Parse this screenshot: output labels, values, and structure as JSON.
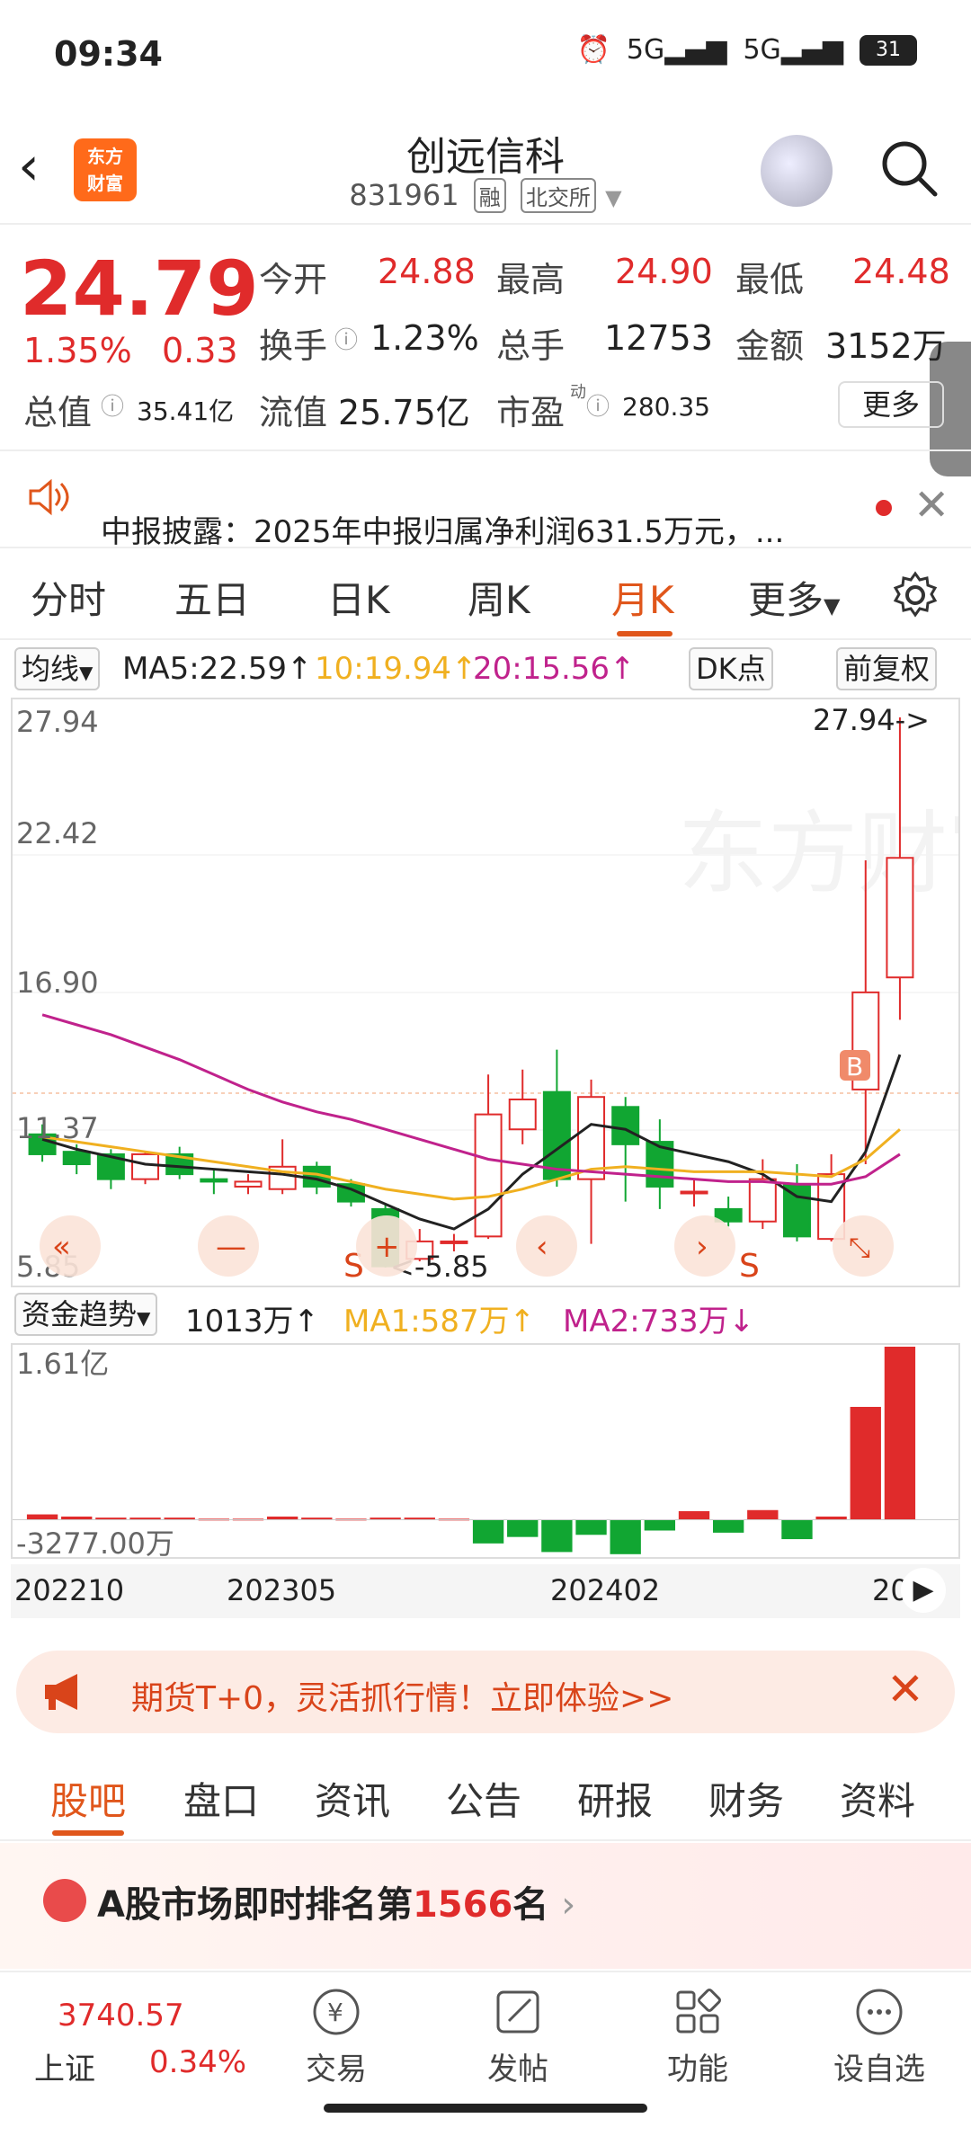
{
  "status_bar": {
    "time": "09:34",
    "signal1": "5G",
    "signal2": "5G",
    "battery": "31"
  },
  "header": {
    "title": "创远信科",
    "code": "831961",
    "tag_margin": "融",
    "tag_exchange": "北交所",
    "logo_line1": "东方",
    "logo_line2": "财富"
  },
  "quote": {
    "price": "24.79",
    "change_pct": "1.35%",
    "change_abs": "0.33",
    "open_label": "今开",
    "open": "24.88",
    "high_label": "最高",
    "high": "24.90",
    "low_label": "最低",
    "low": "24.48",
    "turnover_label": "换手",
    "turnover": "1.23%",
    "volume_label": "总手",
    "volume": "12753",
    "amount_label": "金额",
    "amount": "3152万",
    "mktcap_label": "总值",
    "mktcap": "35.41亿",
    "float_label": "流值",
    "float_cap": "25.75亿",
    "pe_label": "市盈",
    "pe_sup": "动",
    "pe": "280.35",
    "more_label": "更多"
  },
  "notice": {
    "text": "中报披露：2025年中报归属净利润631.5万元，..."
  },
  "tabs": [
    {
      "label": "分时"
    },
    {
      "label": "五日"
    },
    {
      "label": "日K"
    },
    {
      "label": "周K"
    },
    {
      "label": "月K"
    },
    {
      "label": "更多"
    }
  ],
  "indicator": {
    "ma_dropdown": "均线",
    "ma5": "MA5:22.59↑",
    "ma10": "10:19.94↑",
    "ma20": "20:15.56↑",
    "dk_label": "DK点",
    "adjust_label": "前复权"
  },
  "chart_labels": {
    "y1": "27.94",
    "y2": "22.42",
    "y3": "16.90",
    "y4": "11.37",
    "y5": "5.85",
    "high_marker": "27.94->",
    "low_marker": "<-5.85",
    "b_marker": "B",
    "s_marker": "S"
  },
  "fund": {
    "dropdown": "资金趋势",
    "value": "1013万↑",
    "ma1": "MA1:587万↑",
    "ma2": "MA2:733万↓"
  },
  "vol_labels": {
    "top": "1.61亿",
    "bottom": "-3277.00万"
  },
  "date_axis": {
    "d1": "202210",
    "d2": "202305",
    "d3": "202402",
    "d4": "20"
  },
  "ad": {
    "text": "期货T+0，灵活抓行情！立即体验>>"
  },
  "sub_tabs": [
    {
      "label": "股吧"
    },
    {
      "label": "盘口"
    },
    {
      "label": "资讯"
    },
    {
      "label": "公告"
    },
    {
      "label": "研报"
    },
    {
      "label": "财务"
    },
    {
      "label": "资料"
    }
  ],
  "rank": {
    "prefix": "A股市场即时排名第",
    "num": "1566",
    "suffix": "名"
  },
  "bottom_nav": {
    "index_value": "3740.57",
    "index_name": "上证",
    "index_pct": "0.34%",
    "items": [
      {
        "label": "交易"
      },
      {
        "label": "发帖"
      },
      {
        "label": "功能"
      },
      {
        "label": "设自选"
      }
    ]
  },
  "colors": {
    "up": "#e02b2b",
    "down": "#11a632",
    "ma5": "#222222",
    "ma10": "#f0b020",
    "ma20": "#c0228c",
    "accent": "#e0561b"
  },
  "chart_data": {
    "type": "candlestick",
    "x_labels": [
      "202210",
      "202305",
      "202402",
      "20"
    ],
    "ylim": [
      5.85,
      27.94
    ],
    "candles": [
      {
        "o": 11.2,
        "c": 10.4,
        "h": 11.6,
        "l": 10.1
      },
      {
        "o": 10.5,
        "c": 10.0,
        "h": 10.8,
        "l": 9.6
      },
      {
        "o": 10.4,
        "c": 9.4,
        "h": 10.6,
        "l": 9.0
      },
      {
        "o": 9.4,
        "c": 10.4,
        "h": 10.5,
        "l": 9.2
      },
      {
        "o": 10.4,
        "c": 9.6,
        "h": 10.7,
        "l": 9.4
      },
      {
        "o": 9.4,
        "c": 9.3,
        "h": 9.8,
        "l": 8.8
      },
      {
        "o": 9.1,
        "c": 9.3,
        "h": 9.6,
        "l": 8.8
      },
      {
        "o": 9.0,
        "c": 9.9,
        "h": 11.0,
        "l": 8.8
      },
      {
        "o": 9.9,
        "c": 9.1,
        "h": 10.1,
        "l": 8.8
      },
      {
        "o": 9.2,
        "c": 8.5,
        "h": 9.4,
        "l": 8.3
      },
      {
        "o": 8.2,
        "c": 5.9,
        "h": 8.4,
        "l": 5.85
      },
      {
        "o": 6.2,
        "c": 6.9,
        "h": 7.4,
        "l": 6.1
      },
      {
        "o": 6.9,
        "c": 6.9,
        "h": 7.2,
        "l": 6.5
      },
      {
        "o": 7.1,
        "c": 12.0,
        "h": 13.6,
        "l": 7.0
      },
      {
        "o": 11.4,
        "c": 12.6,
        "h": 13.8,
        "l": 10.8
      },
      {
        "o": 12.9,
        "c": 9.4,
        "h": 14.6,
        "l": 9.1
      },
      {
        "o": 9.4,
        "c": 12.7,
        "h": 13.4,
        "l": 6.8
      },
      {
        "o": 12.3,
        "c": 10.8,
        "h": 12.7,
        "l": 8.5
      },
      {
        "o": 10.9,
        "c": 9.1,
        "h": 11.8,
        "l": 8.2
      },
      {
        "o": 8.9,
        "c": 8.9,
        "h": 9.4,
        "l": 8.3
      },
      {
        "o": 8.2,
        "c": 7.7,
        "h": 8.7,
        "l": 7.5
      },
      {
        "o": 7.7,
        "c": 9.4,
        "h": 10.2,
        "l": 7.4
      },
      {
        "o": 9.2,
        "c": 7.1,
        "h": 10.0,
        "l": 6.9
      },
      {
        "o": 7.0,
        "c": 9.6,
        "h": 10.4,
        "l": 6.9
      },
      {
        "o": 13.0,
        "c": 16.9,
        "h": 22.2,
        "l": 10.0
      },
      {
        "o": 17.5,
        "c": 22.3,
        "h": 27.94,
        "l": 15.8
      }
    ],
    "ma5": [
      11.0,
      10.6,
      10.3,
      10.0,
      9.9,
      9.8,
      9.7,
      9.6,
      9.4,
      9.0,
      8.4,
      7.8,
      7.4,
      8.2,
      9.6,
      10.6,
      11.6,
      11.4,
      10.7,
      10.4,
      10.1,
      9.6,
      8.7,
      8.5,
      10.5,
      14.4
    ],
    "ma10": [
      11.1,
      10.9,
      10.7,
      10.5,
      10.3,
      10.1,
      9.9,
      9.7,
      9.6,
      9.3,
      9.0,
      8.8,
      8.6,
      8.7,
      9.0,
      9.4,
      9.8,
      9.9,
      9.8,
      9.7,
      9.7,
      9.7,
      9.6,
      9.5,
      10.2,
      11.4
    ],
    "ma20": [
      16.0,
      15.6,
      15.2,
      14.7,
      14.2,
      13.6,
      13.0,
      12.5,
      12.1,
      11.8,
      11.4,
      11.0,
      10.6,
      10.2,
      10.0,
      9.8,
      9.7,
      9.6,
      9.5,
      9.4,
      9.3,
      9.3,
      9.2,
      9.2,
      9.5,
      10.4
    ],
    "fund_flow": [
      0.5,
      0.3,
      0.2,
      0.2,
      0.2,
      0.1,
      0.1,
      0.3,
      0.2,
      0.1,
      0.2,
      0.2,
      0.1,
      -2.2,
      -1.6,
      -3.0,
      -1.4,
      -3.2,
      -1.0,
      0.8,
      -1.2,
      0.9,
      -1.8,
      0.3,
      10.5,
      16.1
    ]
  }
}
